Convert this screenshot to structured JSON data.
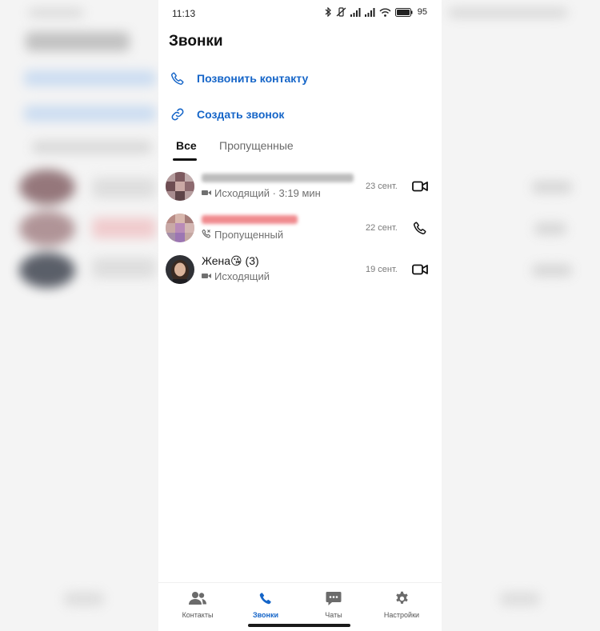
{
  "status_bar": {
    "time": "11:13",
    "battery_percent": "95"
  },
  "page": {
    "title": "Звонки"
  },
  "actions": {
    "call_contact": "Позвонить контакту",
    "create_call": "Создать звонок"
  },
  "tabs": {
    "all": "Все",
    "missed": "Пропущенные",
    "active": "all"
  },
  "calls": [
    {
      "name": "",
      "status": "Исходящий · 3:19 мин",
      "date": "23 сент.",
      "type": "video",
      "status_icon": "video-call-icon",
      "action_icon": "video-icon"
    },
    {
      "name": "",
      "status": "Пропущенный",
      "date": "22 сент.",
      "type": "missed",
      "status_icon": "missed-call-icon",
      "action_icon": "phone-icon"
    },
    {
      "name": "Жена😘 (3)",
      "status": "Исходящий",
      "date": "19 сент.",
      "type": "video",
      "status_icon": "video-call-icon",
      "action_icon": "video-icon"
    }
  ],
  "bottom_nav": {
    "contacts": "Контакты",
    "calls": "Звонки",
    "chats": "Чаты",
    "settings": "Настройки",
    "active": "calls"
  },
  "colors": {
    "accent": "#1565c8",
    "missed_name": "#e8474c"
  }
}
